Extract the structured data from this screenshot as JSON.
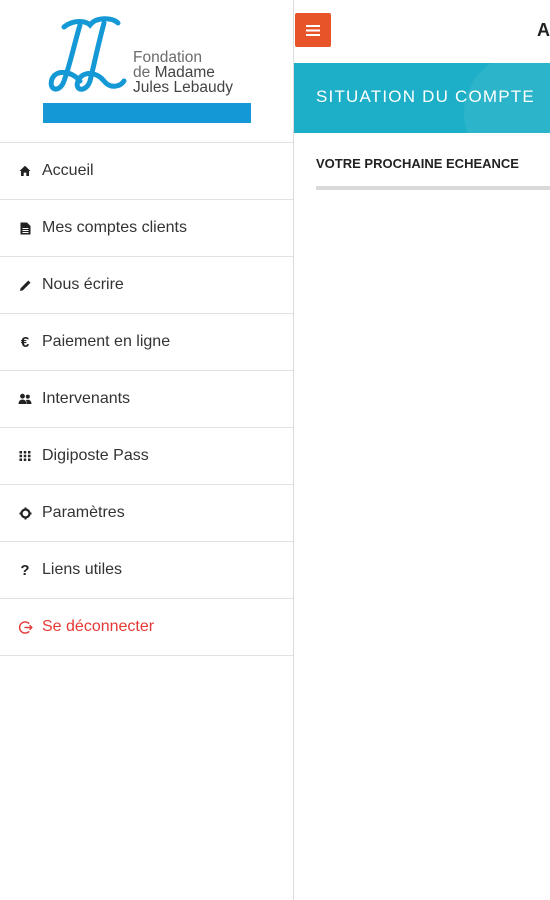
{
  "brand": {
    "line1": "Fondation",
    "line2_prefix": "de ",
    "line2_bold": "Madame",
    "line3": "Jules Lebaudy",
    "color": "#1599d6"
  },
  "menu": {
    "items": [
      {
        "label": "Accueil",
        "icon": "home-icon"
      },
      {
        "label": "Mes comptes clients",
        "icon": "document-icon"
      },
      {
        "label": "Nous écrire",
        "icon": "pencil-icon"
      },
      {
        "label": "Paiement en ligne",
        "icon": "euro-icon"
      },
      {
        "label": "Intervenants",
        "icon": "users-icon"
      },
      {
        "label": "Digiposte Pass",
        "icon": "grid-icon"
      },
      {
        "label": "Paramètres",
        "icon": "gear-icon"
      },
      {
        "label": "Liens utiles",
        "icon": "question-icon"
      },
      {
        "label": "Se déconnecter",
        "icon": "logout-icon"
      }
    ],
    "logout_color": "#e53935"
  },
  "icons": {
    "euro": "€",
    "question": "?"
  },
  "header": {
    "title": "A",
    "menu_button_color": "#e8542a"
  },
  "banner": {
    "title": "SITUATION DU COMPTE",
    "color": "#1cafc7"
  },
  "section": {
    "title": "VOTRE PROCHAINE ECHEANCE"
  }
}
